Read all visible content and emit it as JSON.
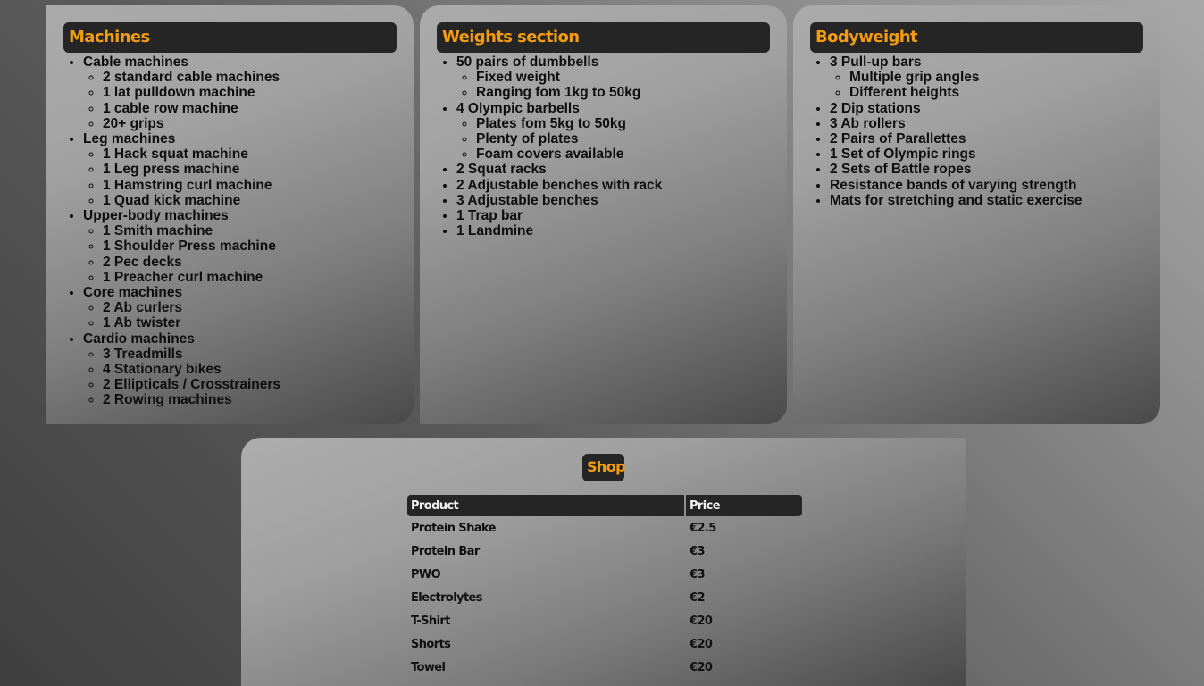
{
  "sections": {
    "machines": {
      "title": "Machines",
      "groups": [
        {
          "label": "Cable machines",
          "items": [
            "2 standard cable machines",
            "1 lat pulldown machine",
            "1 cable row machine",
            "20+ grips"
          ]
        },
        {
          "label": "Leg machines",
          "items": [
            "1 Hack squat machine",
            "1 Leg press machine",
            "1 Hamstring curl machine",
            "1 Quad kick machine"
          ]
        },
        {
          "label": "Upper-body machines",
          "items": [
            "1 Smith machine",
            "1 Shoulder Press machine",
            "2 Pec decks",
            "1 Preacher curl machine"
          ]
        },
        {
          "label": "Core machines",
          "items": [
            "2 Ab curlers",
            "1 Ab twister"
          ]
        },
        {
          "label": "Cardio machines",
          "items": [
            "3 Treadmills",
            "4 Stationary bikes",
            "2 Ellipticals / Crosstrainers",
            "2 Rowing machines"
          ]
        }
      ]
    },
    "weights": {
      "title": "Weights section",
      "groups": [
        {
          "label": "50 pairs of dumbbells",
          "items": [
            "Fixed weight",
            "Ranging fom 1kg to 50kg"
          ]
        },
        {
          "label": "4 Olympic barbells",
          "items": [
            "Plates fom 5kg to 50kg",
            "Plenty of plates",
            "Foam covers available"
          ]
        },
        {
          "label": "2 Squat racks",
          "items": []
        },
        {
          "label": "2 Adjustable benches with rack",
          "items": []
        },
        {
          "label": "3 Adjustable benches",
          "items": []
        },
        {
          "label": "1 Trap bar",
          "items": []
        },
        {
          "label": "1 Landmine",
          "items": []
        }
      ]
    },
    "bodyweight": {
      "title": "Bodyweight",
      "groups": [
        {
          "label": "3 Pull-up bars",
          "items": [
            "Multiple grip angles",
            "Different heights"
          ]
        },
        {
          "label": "2 Dip stations",
          "items": []
        },
        {
          "label": "3 Ab rollers",
          "items": []
        },
        {
          "label": "2 Pairs of Parallettes",
          "items": []
        },
        {
          "label": "1 Set of Olympic rings",
          "items": []
        },
        {
          "label": "2 Sets of Battle ropes",
          "items": []
        },
        {
          "label": "Resistance bands of varying strength",
          "items": []
        },
        {
          "label": "Mats for stretching and static exercise",
          "items": []
        }
      ]
    }
  },
  "shop": {
    "title": "Shop",
    "columns": [
      "Product",
      "Price"
    ],
    "rows": [
      [
        "Protein Shake",
        "€2.5"
      ],
      [
        "Protein Bar",
        "€3"
      ],
      [
        "PWO",
        "€3"
      ],
      [
        "Electrolytes",
        "€2"
      ],
      [
        "T-Shirt",
        "€20"
      ],
      [
        "Shorts",
        "€20"
      ],
      [
        "Towel",
        "€20"
      ]
    ]
  },
  "colors": {
    "accent": "#f39c12",
    "header_bg": "#252525"
  }
}
